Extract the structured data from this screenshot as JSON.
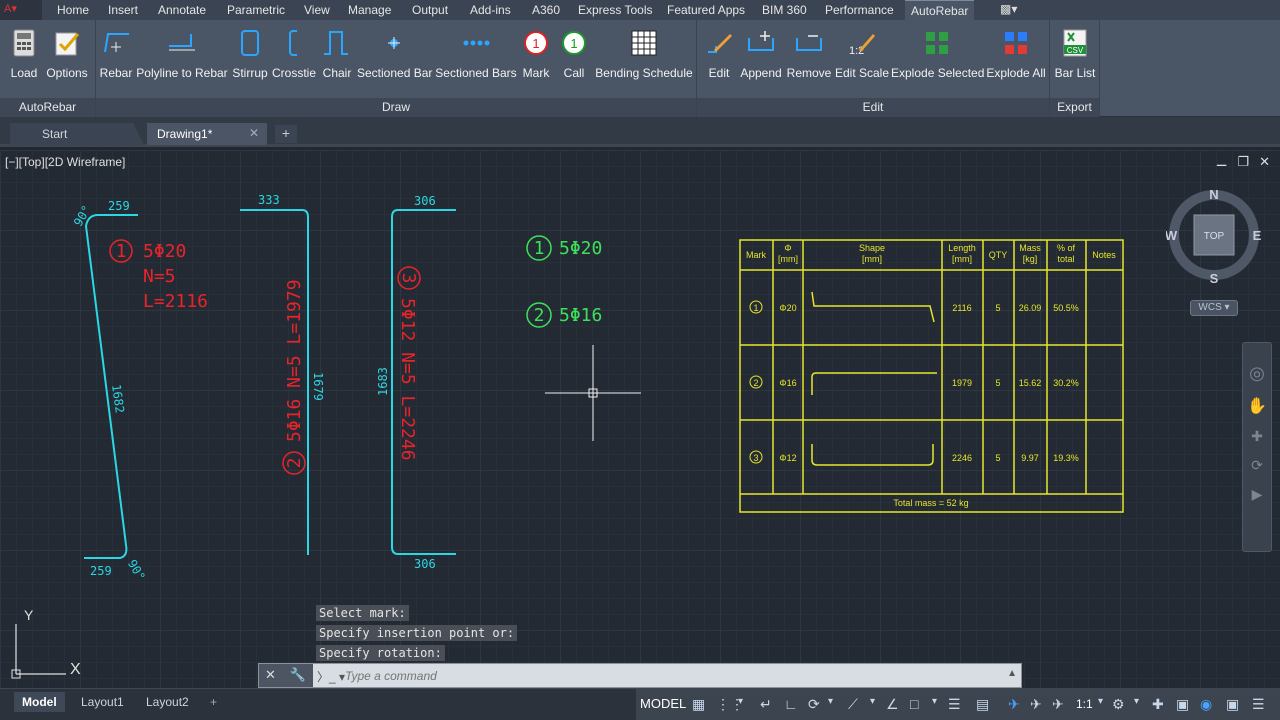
{
  "menubar": {
    "tabs": [
      "Home",
      "Insert",
      "Annotate",
      "Parametric",
      "View",
      "Manage",
      "Output",
      "Add-ins",
      "A360",
      "Express Tools",
      "Featured Apps",
      "BIM 360",
      "Performance",
      "AutoRebar"
    ],
    "active_tab": "AutoRebar"
  },
  "ribbon": {
    "panels": {
      "autorebar": {
        "title": "AutoRebar",
        "buttons": [
          "Load",
          "Options"
        ]
      },
      "draw": {
        "title": "Draw",
        "buttons": [
          "Rebar",
          "Polyline to Rebar",
          "Stirrup",
          "Crosstie",
          "Chair",
          "Sectioned Bar",
          "Sectioned Bars",
          "Mark",
          "Call",
          "Bending Schedule"
        ]
      },
      "edit": {
        "title": "Edit",
        "buttons": [
          "Edit",
          "Append",
          "Remove",
          "Edit Scale",
          "Explode Selected",
          "Explode All"
        ]
      },
      "export": {
        "title": "Export",
        "buttons": [
          "Bar List"
        ]
      }
    },
    "mark_icon_number": "1",
    "call_icon_number": "1",
    "csv_icon_text": "CSV"
  },
  "doc_tabs": {
    "start": "Start",
    "drawing": "Drawing1*"
  },
  "viewport": {
    "label": "[−][Top][2D Wireframe]"
  },
  "drawing": {
    "bar1": {
      "dim_top": "259",
      "dim_side": "1682",
      "dim_bottom": "259",
      "angle_top": "90°",
      "angle_bottom": "90°",
      "mark_num": "1",
      "label1": "5Φ20",
      "label2": "N=5",
      "label3": "L=2116"
    },
    "bar2": {
      "dim_top": "333",
      "dim_side": "1679",
      "mark_num": "2",
      "label": "5Φ16 N=5 L=1979"
    },
    "bar3": {
      "dim_top": "306",
      "dim_side": "1683",
      "dim_bottom": "306",
      "mark_num": "3",
      "label": "5Φ12 N=5 L=2246"
    },
    "calls": [
      {
        "num": "1",
        "text": "5Φ20"
      },
      {
        "num": "2",
        "text": "5Φ16"
      }
    ]
  },
  "schedule": {
    "headers": {
      "mark": "Mark",
      "phi1": "Φ",
      "phi2": "[mm]",
      "shape1": "Shape",
      "shape2": "[mm]",
      "len1": "Length",
      "len2": "[mm]",
      "qty": "QTY",
      "mass1": "Mass",
      "mass2": "[kg]",
      "pct1": "% of",
      "pct2": "total",
      "notes": "Notes"
    },
    "rows": [
      {
        "mark": "1",
        "dia": "Φ20",
        "length": "2116",
        "qty": "5",
        "mass": "26.09",
        "pct": "50.5%"
      },
      {
        "mark": "2",
        "dia": "Φ16",
        "length": "1979",
        "qty": "5",
        "mass": "15.62",
        "pct": "30.2%"
      },
      {
        "mark": "3",
        "dia": "Φ12",
        "length": "2246",
        "qty": "5",
        "mass": "9.97",
        "pct": "19.3%"
      }
    ],
    "total": "Total mass = 52 kg"
  },
  "viewcube": {
    "n": "N",
    "s": "S",
    "e": "E",
    "w": "W",
    "top": "TOP",
    "wcs": "WCS"
  },
  "command": {
    "history": [
      "Select mark:",
      "Specify insertion point or:",
      "Specify rotation:"
    ],
    "placeholder": "Type a command"
  },
  "ucs": {
    "x": "X",
    "y": "Y"
  },
  "layout_tabs": [
    "Model",
    "Layout1",
    "Layout2"
  ],
  "status": {
    "mode": "MODEL",
    "scale": "1:1"
  },
  "colors": {
    "rebar": "#2bd7e3",
    "label": "#e8242b",
    "call": "#3ee05a",
    "schedule": "#e6e62a"
  }
}
